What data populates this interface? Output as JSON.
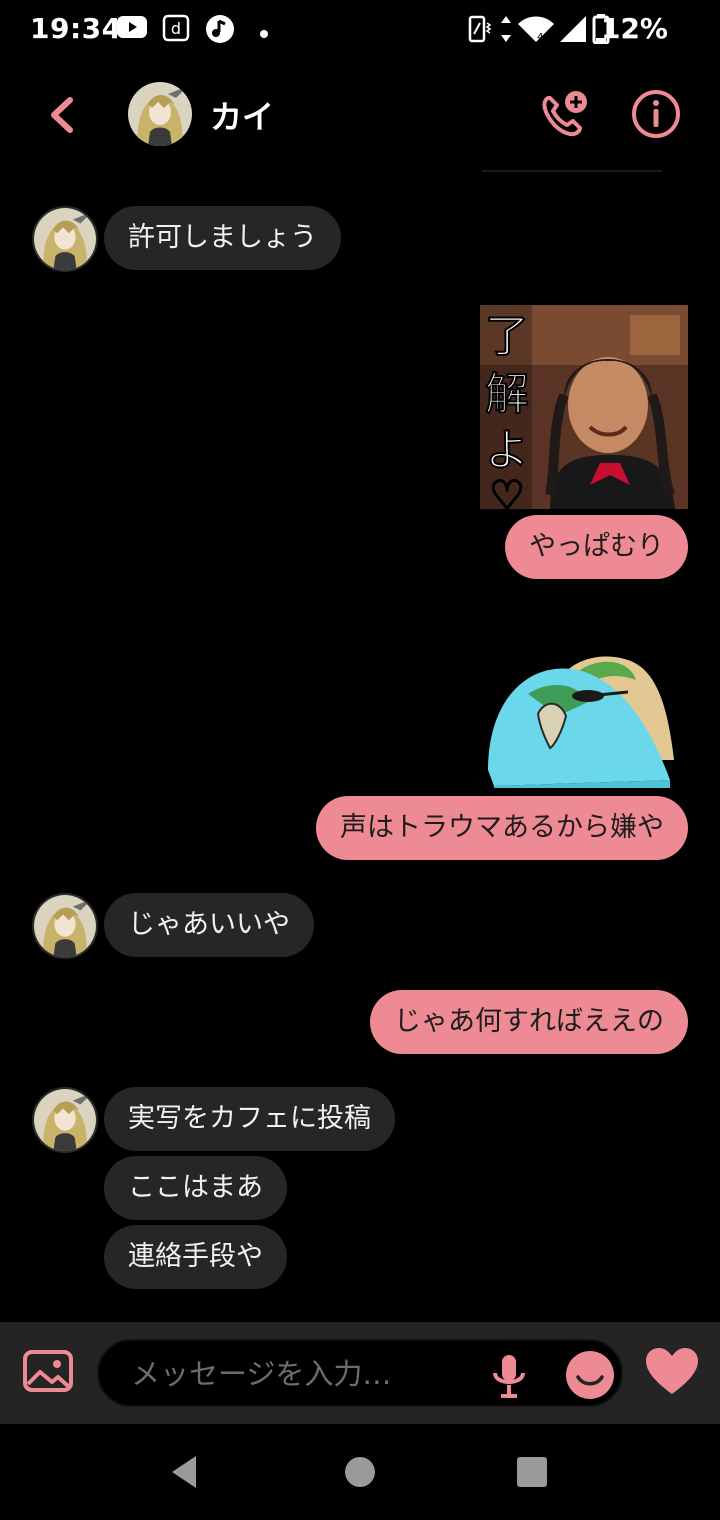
{
  "status_bar": {
    "time": "19:34",
    "battery_percent": "12%",
    "icons": [
      "youtube-icon",
      "d-app-icon",
      "music-icon",
      "dot-icon",
      "vibrate-icon",
      "data-arrows-icon",
      "wifi-icon",
      "signal-icon",
      "battery-icon"
    ]
  },
  "header": {
    "contact_name": "カイ",
    "icons": [
      "chevron-left-icon",
      "phone-add-icon",
      "info-icon"
    ]
  },
  "messages": [
    {
      "side": "in",
      "text": "許可しましょう"
    },
    {
      "side": "out",
      "type": "sticker",
      "sticker_text": "了解よ♡"
    },
    {
      "side": "out",
      "text": "やっぱむり"
    },
    {
      "side": "out",
      "type": "sticker",
      "description": "bird-sticker"
    },
    {
      "side": "out",
      "text": "声はトラウマあるから嫌や"
    },
    {
      "side": "in",
      "text": "じゃあいいや"
    },
    {
      "side": "out",
      "text": "じゃあ何すればええの"
    },
    {
      "side": "in",
      "text": "実写をカフェに投稿"
    },
    {
      "side": "in",
      "text": "ここはまあ"
    },
    {
      "side": "in",
      "text": "連絡手段や"
    }
  ],
  "composer": {
    "placeholder": "メッセージを入力…",
    "icons": [
      "gallery-icon",
      "mic-icon",
      "emoji-icon",
      "heart-icon"
    ]
  },
  "nav_bar": {
    "icons": [
      "nav-back-icon",
      "nav-home-icon",
      "nav-recents-icon"
    ]
  },
  "colors": {
    "accent": "#ee8a94",
    "incoming_bubble": "#262626",
    "background": "#000000"
  }
}
